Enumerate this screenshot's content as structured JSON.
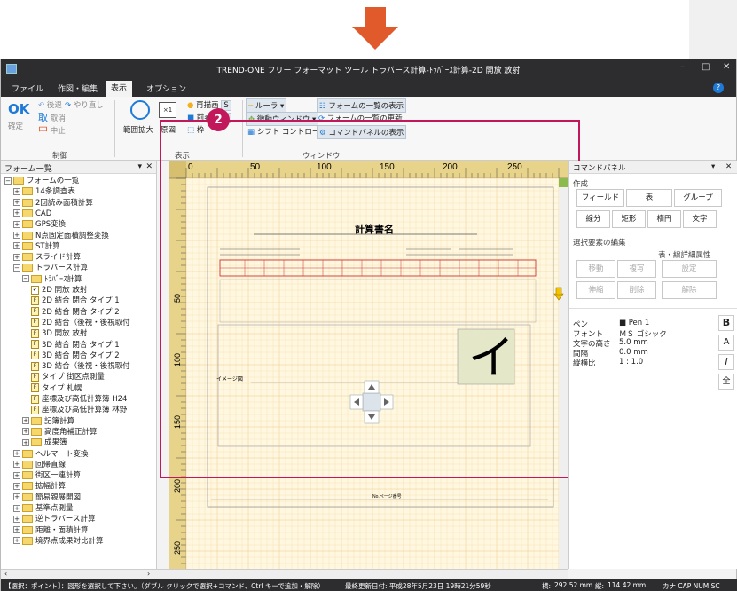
{
  "window": {
    "title": "TREND-ONE フリー フォーマット ツール トラバース計算-ﾄﾗﾊﾞｰｽ計算-2D 開放 放射"
  },
  "menu": {
    "items": [
      "ファイル",
      "作図・編集",
      "表示",
      "オプション"
    ],
    "active_index": 2
  },
  "ribbon": {
    "confirm_label": "確定",
    "ok_label": "OK",
    "back_label": "後退",
    "redo_label": "やり直し",
    "cancel_label": "取消",
    "abort_label": "中止",
    "group_control": "制御",
    "zoom_label": "範囲拡大",
    "original_label": "原図",
    "scale_label": "×1",
    "redraw_label": "再描画",
    "redraw_key": "S",
    "prev_label": "前表示",
    "prev_key": "F",
    "frame_label": "枠",
    "group_display": "表示",
    "ruler_label": "ルーラ",
    "nudge_label": "微動ウィンドウ",
    "shift_label": "シフト コントロール",
    "list_label": "フォームの一覧の表示",
    "update_label": "フォームの一覧の更新",
    "cmdpanel_label": "コマンドパネルの表示",
    "group_window": "ウィンドウ"
  },
  "tree": {
    "header": "フォーム一覧",
    "items": [
      {
        "label": "フォームの一覧",
        "level": 0,
        "type": "folder",
        "expanded": true
      },
      {
        "label": "14条調査表",
        "level": 1,
        "type": "folder"
      },
      {
        "label": "2回読み面積計算",
        "level": 1,
        "type": "folder"
      },
      {
        "label": "CAD",
        "level": 1,
        "type": "folder"
      },
      {
        "label": "GPS変換",
        "level": 1,
        "type": "folder"
      },
      {
        "label": "N点固定面積調整変換",
        "level": 1,
        "type": "folder"
      },
      {
        "label": "ST計算",
        "level": 1,
        "type": "folder"
      },
      {
        "label": "スライド計算",
        "level": 1,
        "type": "folder"
      },
      {
        "label": "トラバース計算",
        "level": 1,
        "type": "folder",
        "expanded": true
      },
      {
        "label": "ﾄﾗﾊﾞｰｽ計算",
        "level": 2,
        "type": "folder",
        "expanded": true
      },
      {
        "label": "2D 開放 放射",
        "level": 3,
        "type": "form",
        "selected": true
      },
      {
        "label": "2D 結合 閉合 タイプ 1",
        "level": 3,
        "type": "form"
      },
      {
        "label": "2D 結合 閉合 タイプ 2",
        "level": 3,
        "type": "form"
      },
      {
        "label": "2D 結合（後視・後視取付",
        "level": 3,
        "type": "form"
      },
      {
        "label": "3D 開放 放射",
        "level": 3,
        "type": "form"
      },
      {
        "label": "3D 結合 閉合 タイプ 1",
        "level": 3,
        "type": "form"
      },
      {
        "label": "3D 結合 閉合 タイプ 2",
        "level": 3,
        "type": "form"
      },
      {
        "label": "3D 結合（後視・後視取付",
        "level": 3,
        "type": "form"
      },
      {
        "label": "タイプ 街区点測量",
        "level": 3,
        "type": "form"
      },
      {
        "label": "タイプ 札幌",
        "level": 3,
        "type": "form"
      },
      {
        "label": "座標及び高低計算簿 H24",
        "level": 3,
        "type": "form"
      },
      {
        "label": "座標及び高低計算簿 林野",
        "level": 3,
        "type": "form"
      },
      {
        "label": "記簿計算",
        "level": 2,
        "type": "folder"
      },
      {
        "label": "高度角補正計算",
        "level": 2,
        "type": "folder"
      },
      {
        "label": "成果簿",
        "level": 2,
        "type": "folder"
      },
      {
        "label": "ヘルマート変換",
        "level": 1,
        "type": "folder"
      },
      {
        "label": "回帰直線",
        "level": 1,
        "type": "folder"
      },
      {
        "label": "街区一連計算",
        "level": 1,
        "type": "folder"
      },
      {
        "label": "拡幅計算",
        "level": 1,
        "type": "folder"
      },
      {
        "label": "簡易親展開図",
        "level": 1,
        "type": "folder"
      },
      {
        "label": "基準点測量",
        "level": 1,
        "type": "folder"
      },
      {
        "label": "逆トラバース計算",
        "level": 1,
        "type": "folder"
      },
      {
        "label": "距離・面積計算",
        "level": 1,
        "type": "folder"
      },
      {
        "label": "境界点成果対比計算",
        "level": 1,
        "type": "folder"
      }
    ]
  },
  "canvas": {
    "badge": "2",
    "ruler_h_ticks": [
      "0",
      "50",
      "100",
      "150",
      "200",
      "250"
    ],
    "ruler_v_ticks": [
      "50",
      "100",
      "150",
      "200",
      "250",
      "300"
    ],
    "form_title": "計算書名",
    "image_label": "イメージ図",
    "big_char": "イ",
    "page_label": "No.ページ番号"
  },
  "command_panel": {
    "header": "コマンドパネル",
    "section_create": "作成",
    "btn_field": "フィールド",
    "btn_table": "表",
    "btn_group": "グループ",
    "btn_line": "線分",
    "btn_rect": "矩形",
    "btn_ellipse": "楕円",
    "btn_text": "文字",
    "section_edit": "選択要素の編集",
    "section_table_attr": "表・線詳細属性",
    "btn_move": "移動",
    "btn_copy": "複写",
    "btn_setting": "設定",
    "btn_stretch": "伸縮",
    "btn_delete": "削除",
    "btn_release": "解除",
    "props": [
      {
        "key": "ペン",
        "value": "Pen 1"
      },
      {
        "key": "フォント",
        "value": "ＭＳ ゴシック"
      },
      {
        "key": "文字の高さ",
        "value": "5.0 mm"
      },
      {
        "key": "間隔",
        "value": "0.0 mm"
      },
      {
        "key": "縦横比",
        "value": "1 : 1.0"
      }
    ],
    "fmt_buttons": [
      "B",
      "A",
      "I",
      "全"
    ]
  },
  "status": {
    "hint": "【選択：ポイント】：図形を選択して下さい。（ダブル クリックで選択+コマンド、Ctrl キーで追加・解除）",
    "updated": "最終更新日付: 平成28年5月23日 19時21分59秒",
    "x_label": "横:",
    "x_value": "292.52 mm",
    "y_label": "縦:",
    "y_value": "114.42 mm",
    "kana": "カナ CAP NUM SC"
  },
  "colors": {
    "accent": "#e05a2b",
    "highlight_border": "#c2185b",
    "titlebar": "#2d2d30"
  }
}
